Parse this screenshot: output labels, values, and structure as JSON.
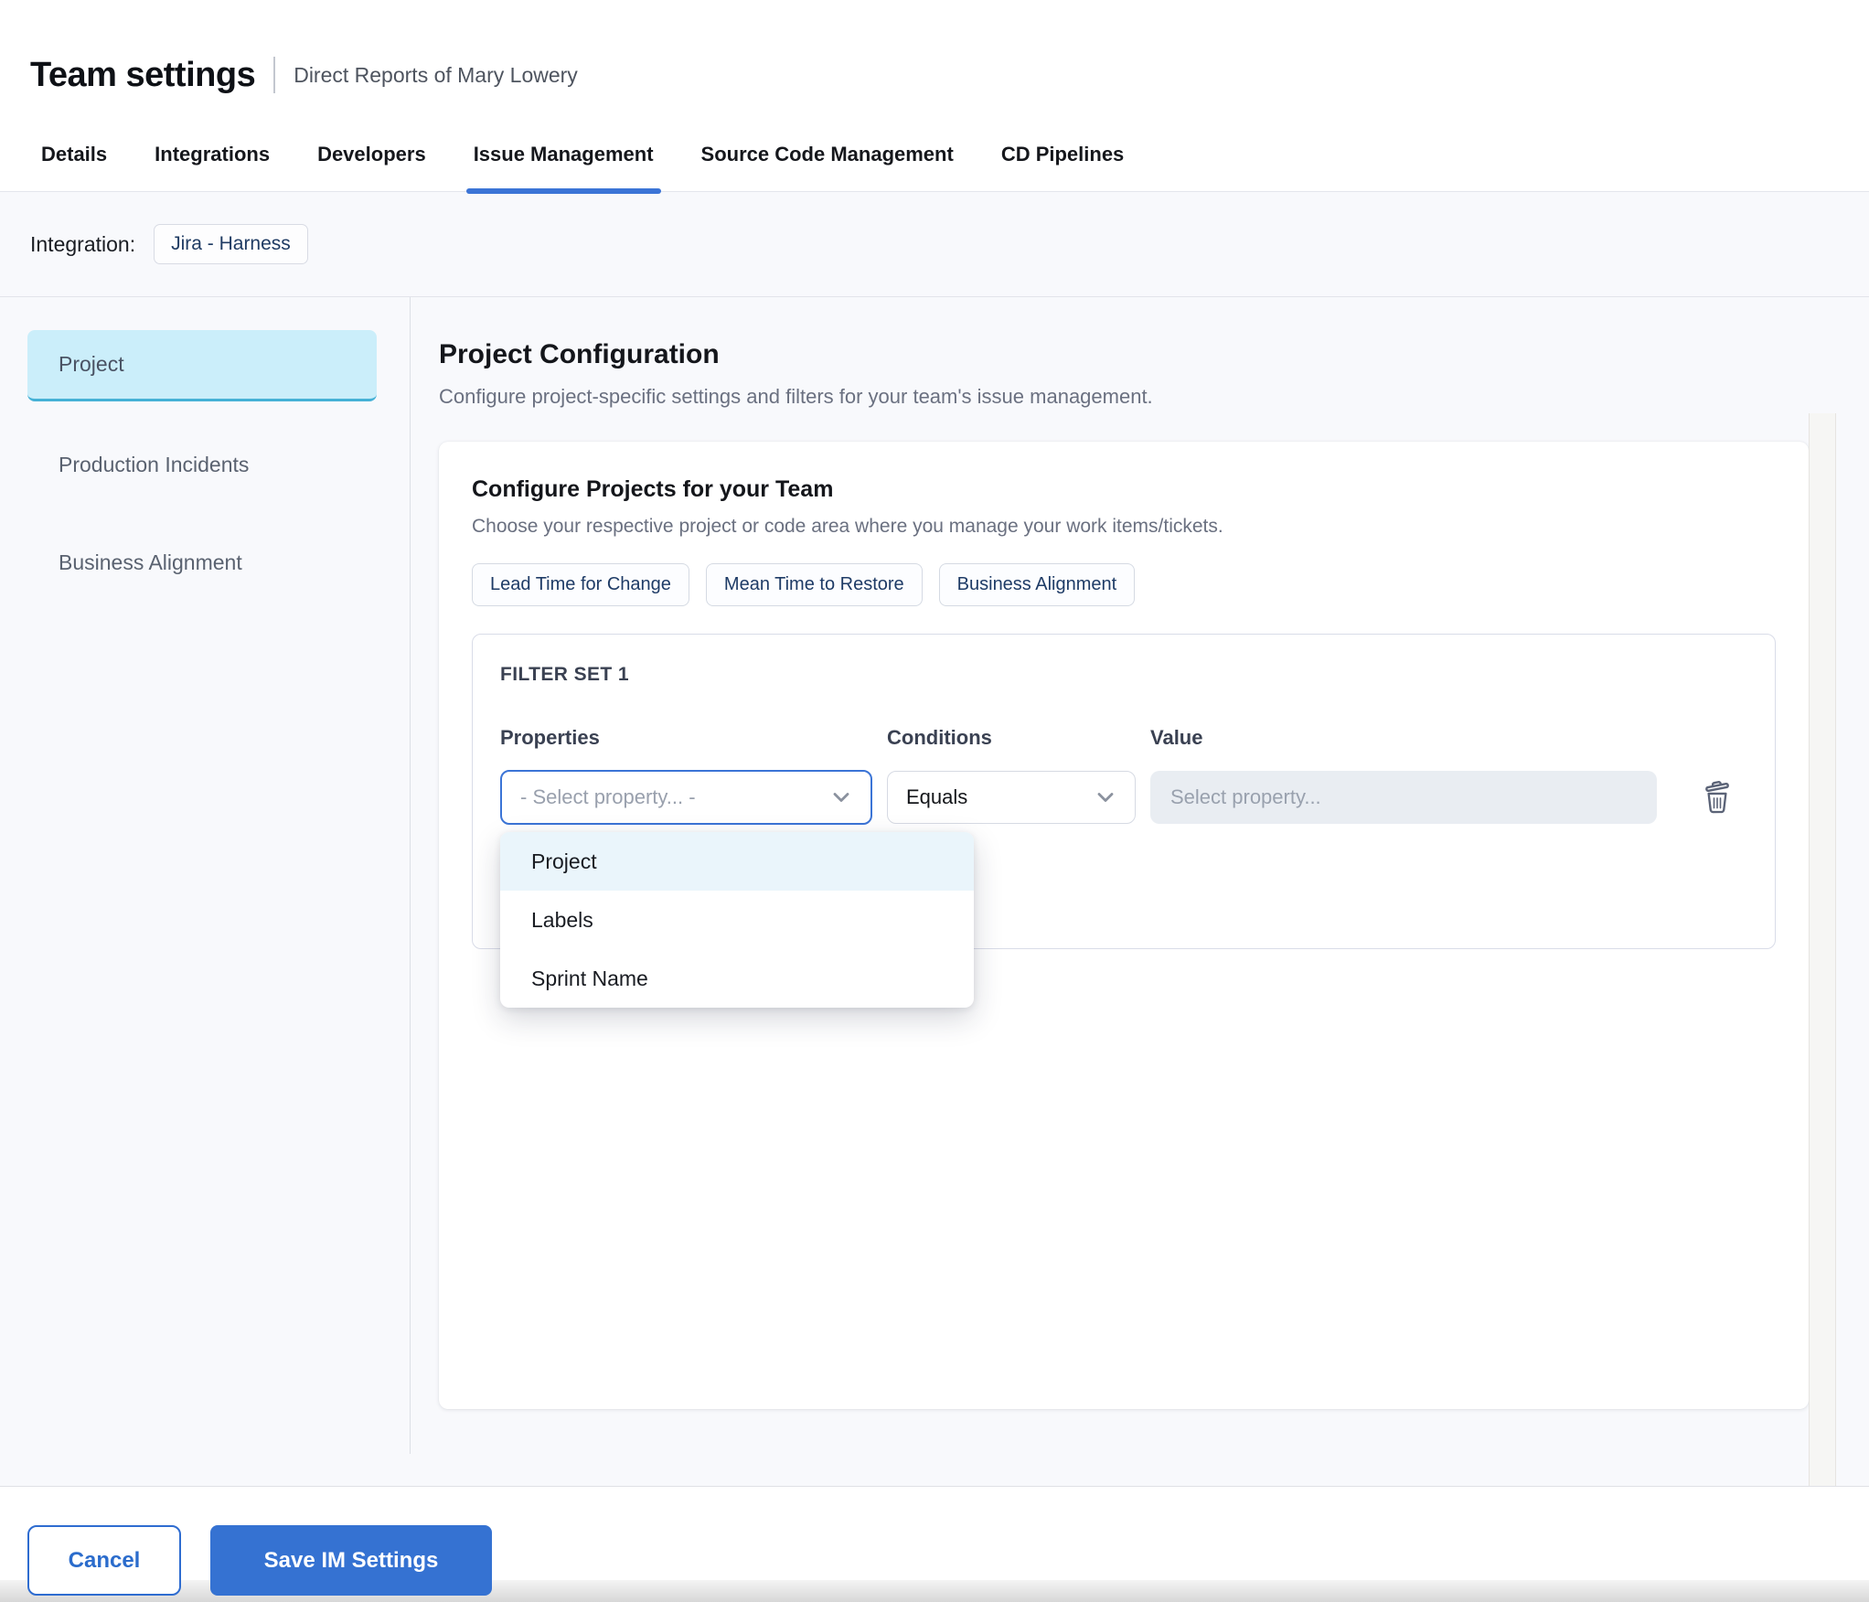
{
  "colors": {
    "accent_blue": "#3b74d6",
    "save_button_blue": "#3572d2",
    "sidebar_selected_bg": "#cbeefa",
    "sidebar_selected_border": "#45b1d6",
    "menu_highlight_bg": "#eaf5fb",
    "chip_text_navy": "#1e3b66"
  },
  "header": {
    "title": "Team settings",
    "subtitle": "Direct Reports of Mary Lowery"
  },
  "tabs": {
    "items": [
      {
        "label": "Details"
      },
      {
        "label": "Integrations"
      },
      {
        "label": "Developers"
      },
      {
        "label": "Issue Management",
        "active": true
      },
      {
        "label": "Source Code Management"
      },
      {
        "label": "CD Pipelines"
      }
    ]
  },
  "integration": {
    "label": "Integration:",
    "chip": "Jira - Harness"
  },
  "sidebar": {
    "items": [
      {
        "label": "Project",
        "selected": true
      },
      {
        "label": "Production Incidents"
      },
      {
        "label": "Business Alignment"
      }
    ]
  },
  "main": {
    "title": "Project Configuration",
    "subtitle": "Configure project-specific settings and filters for your team's issue management.",
    "card": {
      "title": "Configure Projects for your Team",
      "subtitle": "Choose your respective project or code area where you manage your work items/tickets.",
      "chips": [
        {
          "label": "Lead Time for Change"
        },
        {
          "label": "Mean Time to Restore"
        },
        {
          "label": "Business Alignment"
        }
      ],
      "filter_set": {
        "title": "FILTER SET 1",
        "columns": {
          "properties": "Properties",
          "conditions": "Conditions",
          "value": "Value"
        },
        "property_select": {
          "placeholder": "- Select property... -"
        },
        "condition_select": {
          "value": "Equals"
        },
        "value_input": {
          "placeholder": "Select property..."
        },
        "dropdown": {
          "options": [
            {
              "label": "Project",
              "highlighted": true
            },
            {
              "label": "Labels"
            },
            {
              "label": "Sprint Name"
            }
          ]
        }
      }
    }
  },
  "footer": {
    "cancel_label": "Cancel",
    "save_label": "Save IM Settings"
  }
}
